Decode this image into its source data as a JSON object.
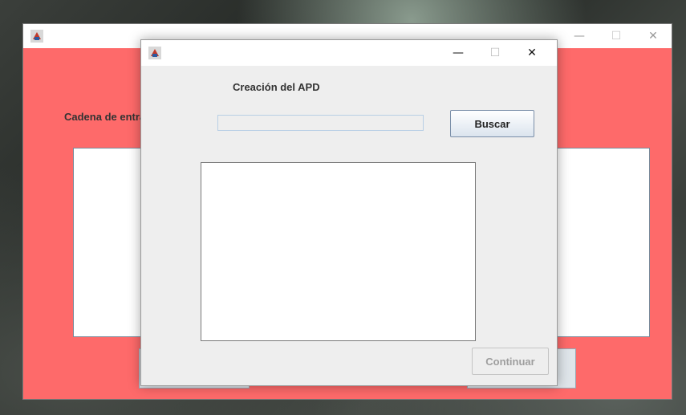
{
  "back_window": {
    "label": "Cadena de entra",
    "controls": {
      "minimize": "—",
      "maximize": "☐",
      "close": "✕"
    }
  },
  "dialog": {
    "title": "Creación del APD",
    "search_field_value": "",
    "buscar_label": "Buscar",
    "continuar_label": "Continuar",
    "controls": {
      "minimize": "—",
      "maximize": "☐",
      "close": "✕"
    }
  }
}
